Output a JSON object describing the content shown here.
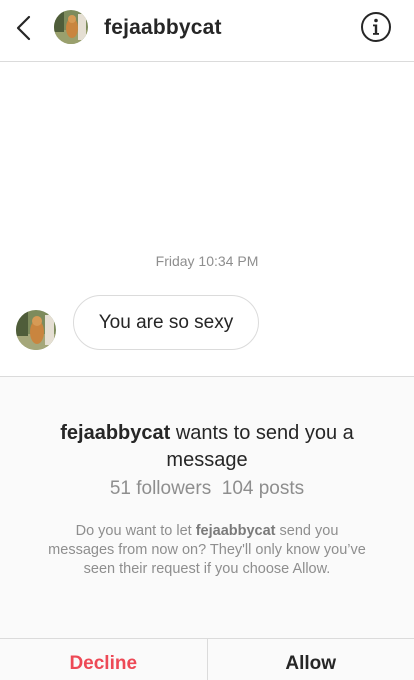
{
  "header": {
    "username": "fejaabbycat",
    "back_icon": "chevron-left-icon",
    "info_icon": "info-icon"
  },
  "thread": {
    "timestamp": "Friday 10:34 PM",
    "message": "You are so sexy"
  },
  "request": {
    "title_user": "fejaabbycat",
    "title_rest": " wants to send you a message",
    "followers": "51 followers",
    "posts": "104 posts",
    "desc_prefix": "Do you want to let ",
    "desc_user": "fejaabbycat",
    "desc_suffix": " send you messages from now on? They'll only know you’ve seen their request if you choose Allow."
  },
  "actions": {
    "decline_label": "Decline",
    "allow_label": "Allow"
  },
  "colors": {
    "decline": "#ed4956",
    "muted": "#8e8e8e",
    "border": "#dbdbdb",
    "panel": "#fafafa"
  }
}
